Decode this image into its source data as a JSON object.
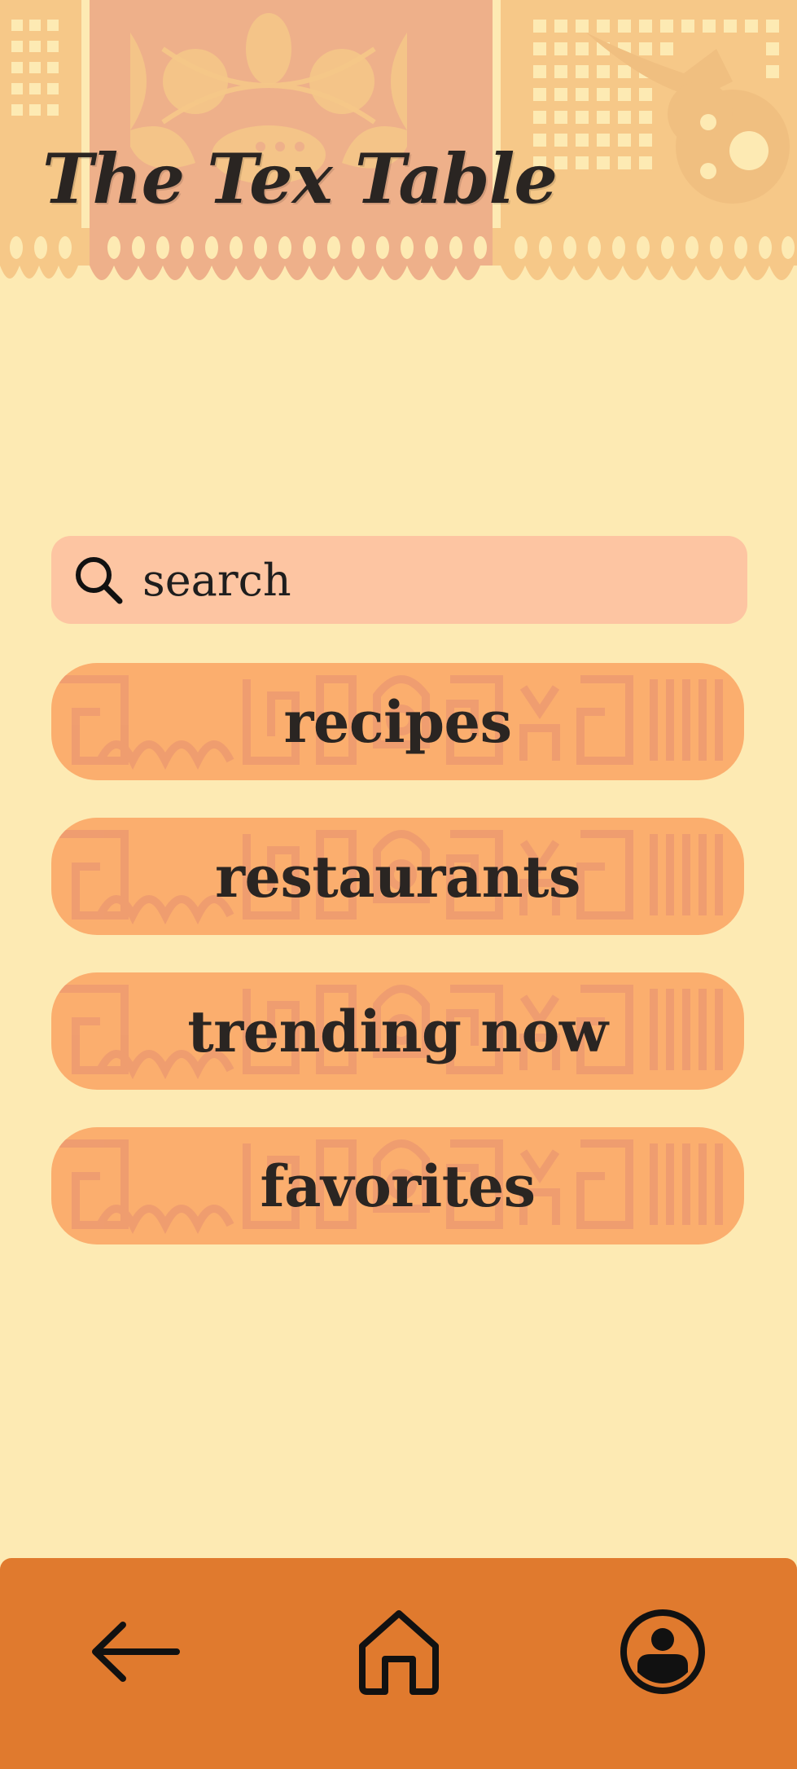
{
  "app": {
    "title": "The Tex Table"
  },
  "search": {
    "placeholder": "search",
    "value": "",
    "icon": "search-icon"
  },
  "menu": [
    {
      "label": "recipes"
    },
    {
      "label": "restaurants"
    },
    {
      "label": "trending now"
    },
    {
      "label": "favorites"
    }
  ],
  "bottom_nav": [
    {
      "icon": "back-arrow-icon"
    },
    {
      "icon": "home-icon"
    },
    {
      "icon": "profile-icon"
    }
  ],
  "colors": {
    "background": "#FDEAB3",
    "search_bg": "#FDC5A2",
    "button_bg": "#FBAE6E",
    "button_pattern": "#EE9C70",
    "nav_bg": "#E07A2E",
    "text": "#2A2522",
    "banner_light": "#F6C888",
    "banner_pink": "#EEB08A"
  }
}
